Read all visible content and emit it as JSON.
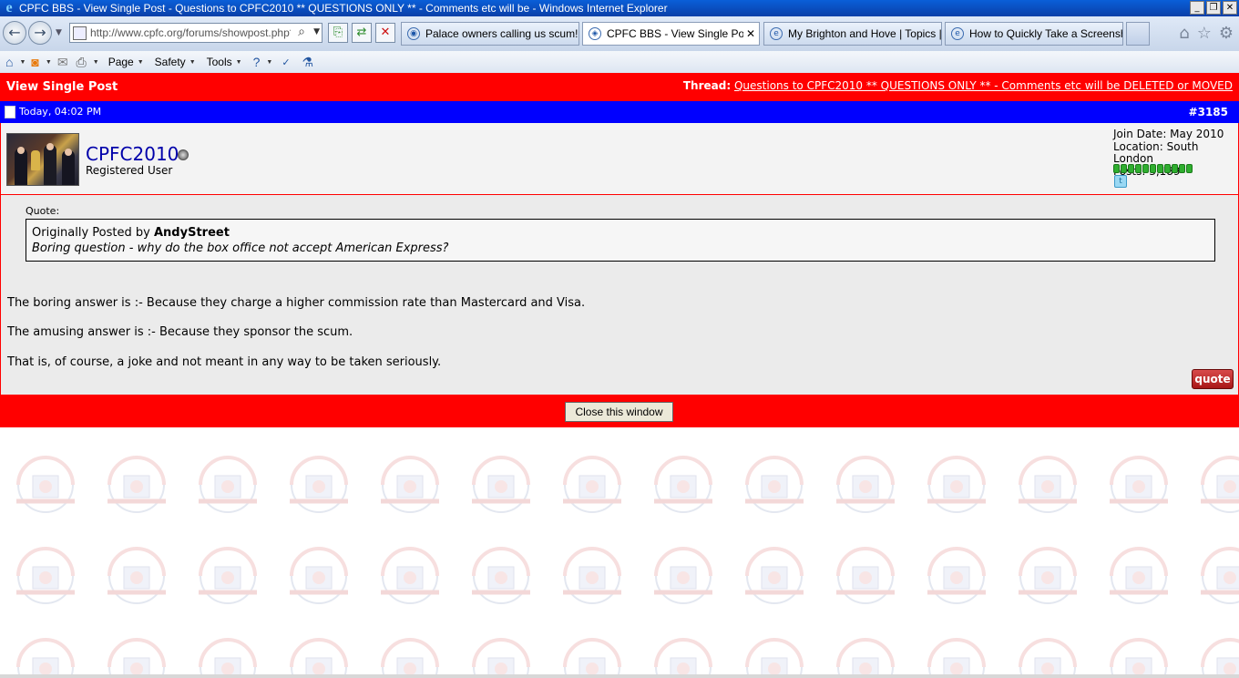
{
  "window": {
    "title": "CPFC BBS - View Single Post - Questions to CPFC2010 ** QUESTIONS ONLY ** - Comments etc will be - Windows Internet Explorer",
    "min_label": "_",
    "max_label": "❐",
    "close_label": "✕"
  },
  "browser": {
    "address": "http://www.cpfc.org/forums/showpost.php?p",
    "tabs": [
      {
        "label": "Palace owners calling us scum!",
        "active": false
      },
      {
        "label": "CPFC BBS - View Single Post ...",
        "active": true
      },
      {
        "label": "My Brighton and Hove | Topics |...",
        "active": false
      },
      {
        "label": "How to Quickly Take a Screensh...",
        "active": false
      }
    ],
    "commands": {
      "page": "Page",
      "safety": "Safety",
      "tools": "Tools"
    }
  },
  "post": {
    "view_title": "View Single Post",
    "thread_label": "Thread:",
    "thread_title": "Questions to CPFC2010 ** QUESTIONS ONLY ** - Comments etc will be DELETED or MOVED",
    "date": "Today, 04:02 PM",
    "number": "#3185",
    "username": "CPFC2010",
    "user_title": "Registered User",
    "join_date": "Join Date: May 2010",
    "location": "Location: South London",
    "posts": "Posts: 3,189",
    "reputation_pips": 11,
    "quote_label": "Quote:",
    "quote_posted_by": "Originally Posted by",
    "quote_author": "AndyStreet",
    "quote_text": "Boring question - why do the box office not accept American Express?",
    "body": [
      "The boring answer is :- Because they charge a higher commission rate than Mastercard and Visa.",
      "The amusing answer is :- Because they sponsor the scum.",
      "That is, of course, a joke and not meant in any way to be taken seriously."
    ],
    "quote_button": "quote",
    "close_button": "Close this window"
  },
  "colors": {
    "header_red": "#ff0000",
    "date_bar_blue": "#0000ff",
    "username_blue": "#0000aa",
    "post_bg": "#ebebeb"
  }
}
